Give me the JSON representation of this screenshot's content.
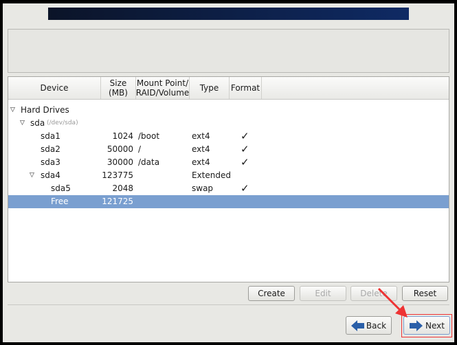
{
  "table": {
    "headers": [
      "Device",
      "Size (MB)",
      "Mount Point/ RAID/Volume",
      "Type",
      "Format"
    ],
    "header_lines": {
      "size": [
        "Size",
        "(MB)"
      ],
      "mount": [
        "Mount Point/",
        "RAID/Volume"
      ]
    },
    "group": "Hard Drives",
    "disk": {
      "name": "sda",
      "path": "(/dev/sda)"
    },
    "rows": [
      {
        "device": "sda1",
        "size": "1024",
        "mount": "/boot",
        "type": "ext4",
        "format": "✓"
      },
      {
        "device": "sda2",
        "size": "50000",
        "mount": "/",
        "type": "ext4",
        "format": "✓"
      },
      {
        "device": "sda3",
        "size": "30000",
        "mount": "/data",
        "type": "ext4",
        "format": "✓"
      },
      {
        "device": "sda4",
        "size": "123775",
        "mount": "",
        "type": "Extended",
        "format": ""
      },
      {
        "device": "sda5",
        "size": "2048",
        "mount": "",
        "type": "swap",
        "format": "✓"
      },
      {
        "device": "Free",
        "size": "121725",
        "mount": "",
        "type": "",
        "format": ""
      }
    ],
    "selected_row": "Free"
  },
  "buttons": {
    "create": "Create",
    "edit": "Edit",
    "delete": "Delete",
    "reset": "Reset",
    "back": "Back",
    "next": "Next"
  },
  "colors": {
    "selection": "#7a9fd0",
    "annotation": "#ee3333",
    "arrow_icon": "#2a5fa8"
  }
}
